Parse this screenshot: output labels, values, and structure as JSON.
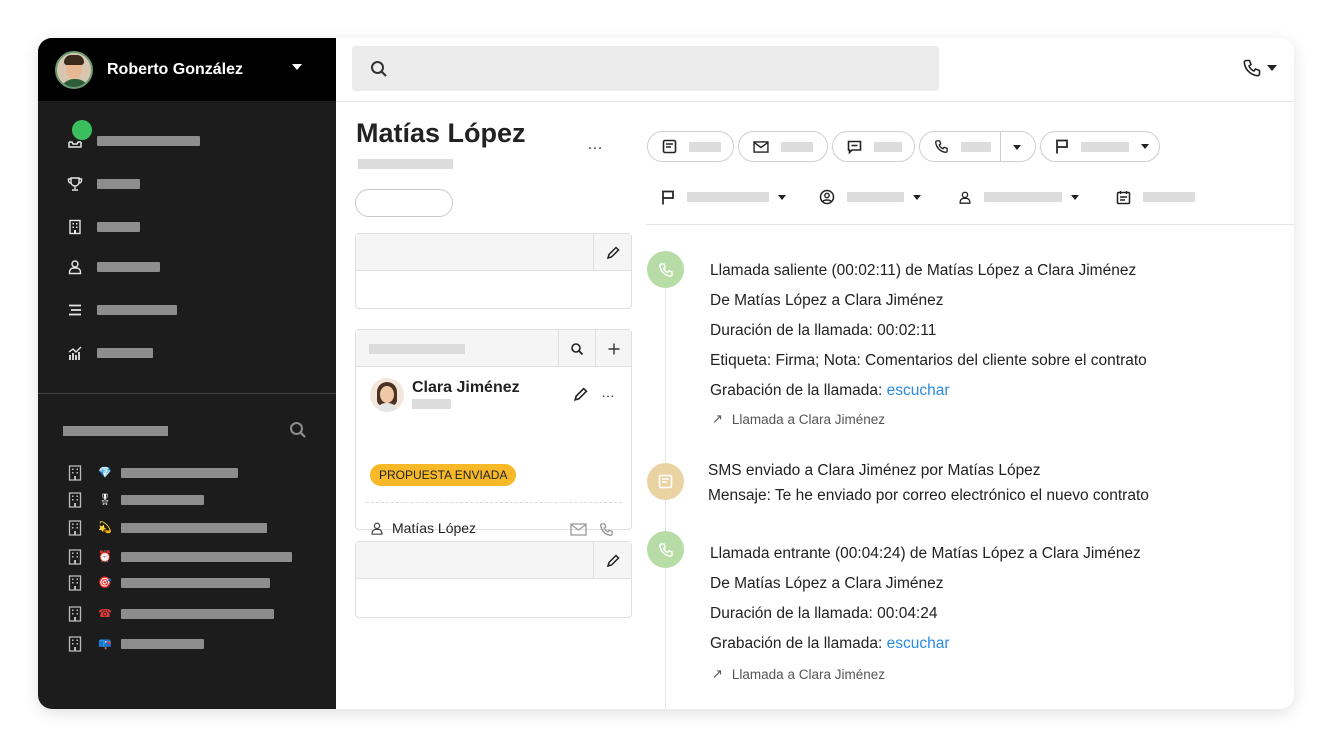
{
  "user": {
    "name": "Roberto González"
  },
  "contact": {
    "name": "Matías López",
    "more": "…"
  },
  "deal": {
    "person": "Clara Jiménez",
    "status": "PROPUESTA ENVIADA",
    "owner": "Matías López",
    "more": "…"
  },
  "sidebar": {
    "nav": [
      {
        "icon": "inbox-icon"
      },
      {
        "icon": "trophy-icon"
      },
      {
        "icon": "building-icon"
      },
      {
        "icon": "person-icon"
      },
      {
        "icon": "list-icon"
      },
      {
        "icon": "chart-icon"
      }
    ],
    "companies": [
      "💎",
      "🎖",
      "💫",
      "⏰",
      "🎯",
      "☎",
      "📪"
    ]
  },
  "timeline": [
    {
      "type": "call",
      "title": "Llamada saliente (00:02:11) de Matías López a Clara Jiménez",
      "from_to": "De Matías López a Clara Jiménez",
      "duration": "Duración de la llamada: 00:02:11",
      "tag": "Etiqueta: Firma; Nota: Comentarios del cliente sobre el contrato",
      "recording_label": "Grabación de la llamada: ",
      "recording_link": "escuchar",
      "footer": "Llamada a Clara Jiménez"
    },
    {
      "type": "sms",
      "title": "SMS enviado a Clara Jiménez por Matías López",
      "message": "Mensaje: Te he enviado por correo electrónico el nuevo contrato"
    },
    {
      "type": "call",
      "title": "Llamada entrante (00:04:24) de Matías López a Clara Jiménez",
      "from_to": "De Matías López a Clara Jiménez",
      "duration": "Duración de la llamada: 00:04:24",
      "recording_label": "Grabación de la llamada: ",
      "recording_link": "escuchar",
      "footer": "Llamada a Clara Jiménez"
    }
  ],
  "colors": {
    "sidebar_bg": "#1c1c1c",
    "header_bg": "#000000",
    "online_dot": "#3bbf5e",
    "badge": "#f7b928",
    "call_icon_bg": "#b7dca5",
    "sms_icon_bg": "#ead3a3",
    "link": "#2a8ae0"
  }
}
